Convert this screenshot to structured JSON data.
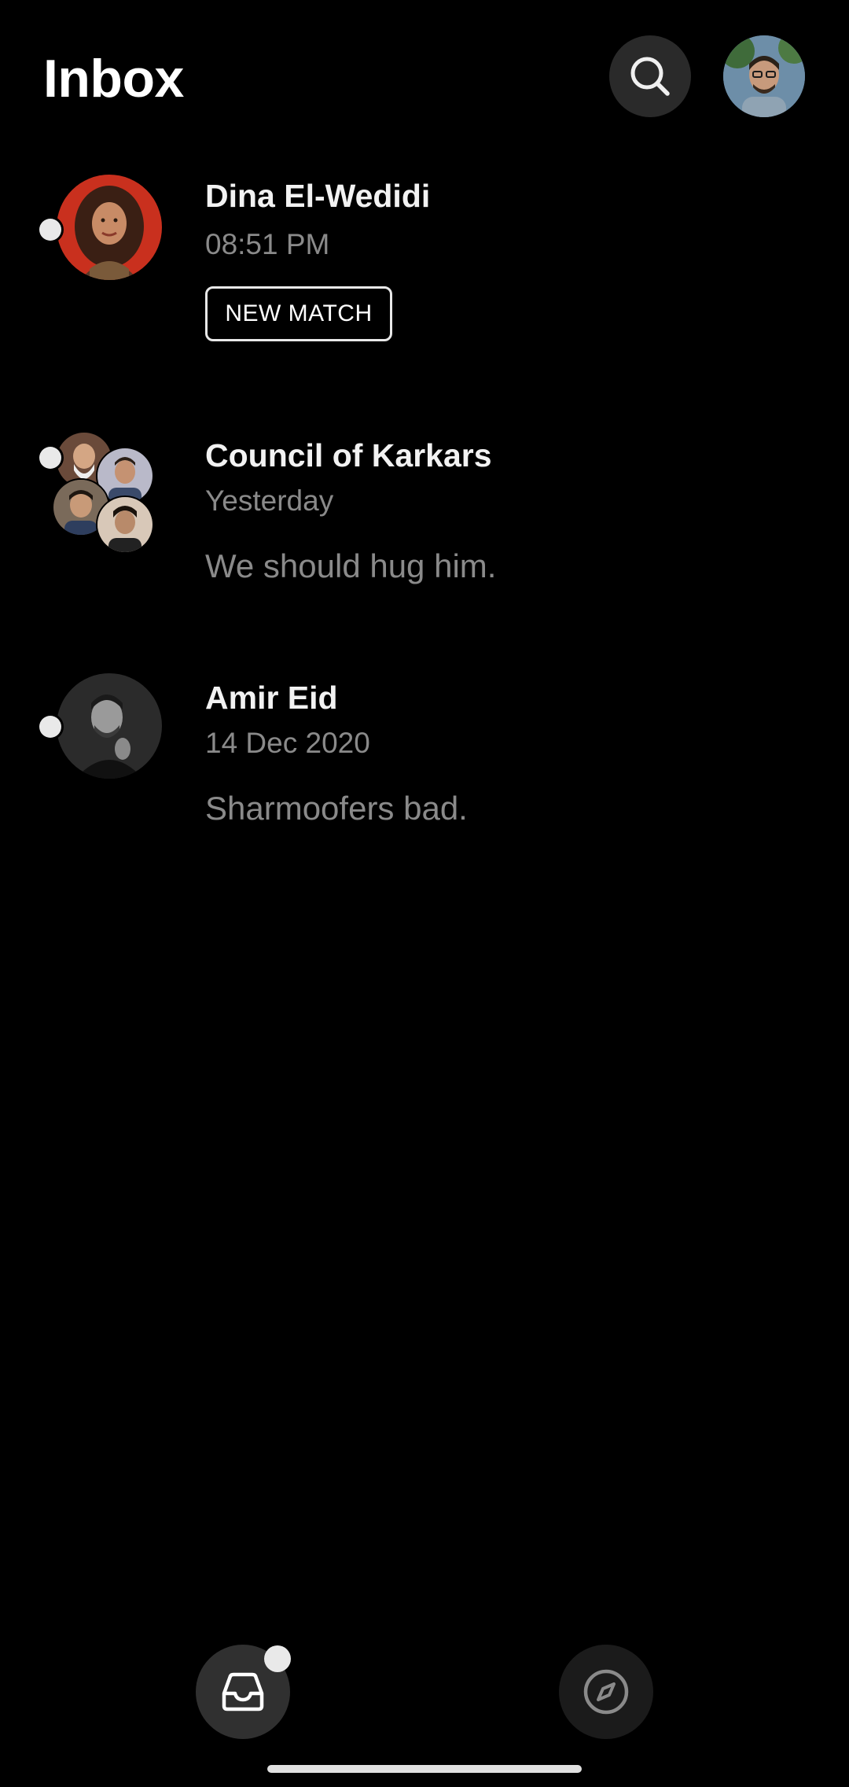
{
  "header": {
    "title": "Inbox",
    "search_icon": "search-icon",
    "profile_avatar": "profile-avatar"
  },
  "conversations": [
    {
      "name": "Dina El-Wedidi",
      "time": "08:51 PM",
      "badge": "NEW MATCH",
      "unread": true,
      "avatar_color": "#c9301e"
    },
    {
      "name": "Council of Karkars",
      "time": "Yesterday",
      "preview": "We should hug him.",
      "unread": true,
      "group": true
    },
    {
      "name": "Amir Eid",
      "time": "14 Dec 2020",
      "preview": "Sharmoofers bad.",
      "unread": true,
      "avatar_color": "#2b2b2b"
    }
  ],
  "bottom_nav": {
    "items": [
      {
        "icon": "inbox-tray-icon",
        "active": true,
        "badge": true
      },
      {
        "icon": "compass-icon",
        "active": false
      }
    ]
  },
  "colors": {
    "background": "#000000",
    "primary_text": "#f2f2f2",
    "secondary_text": "#8a8a8a",
    "unread_dot": "#e9e9e9"
  }
}
